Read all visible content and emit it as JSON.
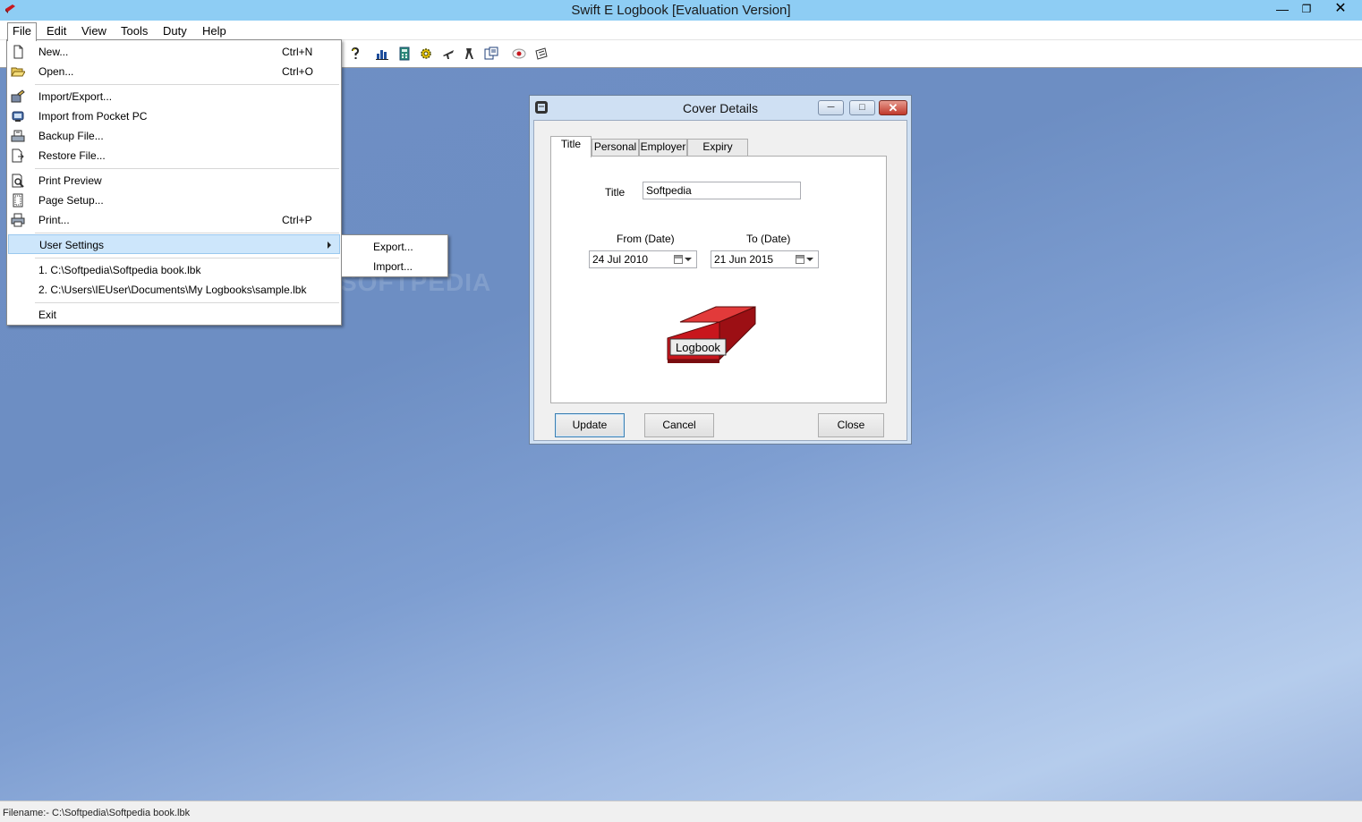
{
  "window": {
    "title": "Swift E Logbook [Evaluation Version]",
    "controls": {
      "minimize": "—",
      "restore": "❐",
      "close": "✕"
    }
  },
  "menubar": {
    "items": [
      "File",
      "Edit",
      "View",
      "Tools",
      "Duty",
      "Help"
    ],
    "open_item": "File"
  },
  "toolbar": {
    "icons": [
      "help-icon",
      "chart-icon",
      "calculator-icon",
      "settings-icon",
      "aircraft-icon",
      "tools-icon",
      "book-icon",
      "clock-icon",
      "note-icon"
    ]
  },
  "file_menu": {
    "items": [
      {
        "label": "New...",
        "shortcut": "Ctrl+N",
        "icon": "new-file-icon"
      },
      {
        "label": "Open...",
        "shortcut": "Ctrl+O",
        "icon": "open-folder-icon"
      },
      {
        "label": "Import/Export...",
        "shortcut": "",
        "icon": "import-export-icon"
      },
      {
        "label": "Import from Pocket PC",
        "shortcut": "",
        "icon": "pocket-pc-icon"
      },
      {
        "label": "Backup File...",
        "shortcut": "",
        "icon": "backup-icon"
      },
      {
        "label": "Restore File...",
        "shortcut": "",
        "icon": "restore-icon"
      },
      {
        "label": "Print Preview",
        "shortcut": "",
        "icon": "print-preview-icon"
      },
      {
        "label": "Page Setup...",
        "shortcut": "",
        "icon": "page-setup-icon"
      },
      {
        "label": "Print...",
        "shortcut": "Ctrl+P",
        "icon": "printer-icon"
      },
      {
        "label": "User Settings",
        "shortcut": "",
        "icon": ""
      },
      {
        "label": "1.  C:\\Softpedia\\Softpedia book.lbk",
        "shortcut": "",
        "icon": ""
      },
      {
        "label": "2.  C:\\Users\\IEUser\\Documents\\My Logbooks\\sample.lbk",
        "shortcut": "",
        "icon": ""
      },
      {
        "label": "Exit",
        "shortcut": "",
        "icon": ""
      }
    ],
    "highlighted": "User Settings"
  },
  "user_settings_submenu": {
    "items": [
      "Export...",
      "Import..."
    ]
  },
  "watermark": "SOFTPEDIA",
  "dialog": {
    "title": "Cover Details",
    "tabs": [
      "Title",
      "Personal",
      "Employer",
      "Expiry Dates"
    ],
    "active_tab": "Title",
    "title_label": "Title",
    "title_value": "Softpedia",
    "from_label": "From (Date)",
    "from_value": "24  Jul  2010",
    "to_label": "To (Date)",
    "to_value": "21 Jun  2015",
    "book_label": "Logbook",
    "buttons": {
      "update": "Update",
      "cancel": "Cancel",
      "close": "Close"
    }
  },
  "statusbar": {
    "text": "Filename:- C:\\Softpedia\\Softpedia book.lbk"
  },
  "colors": {
    "titlebar": "#8ecdf4",
    "menu_highlight": "#cde6fb",
    "book_red": "#c8161d",
    "desktop": "#7e9ed1"
  }
}
